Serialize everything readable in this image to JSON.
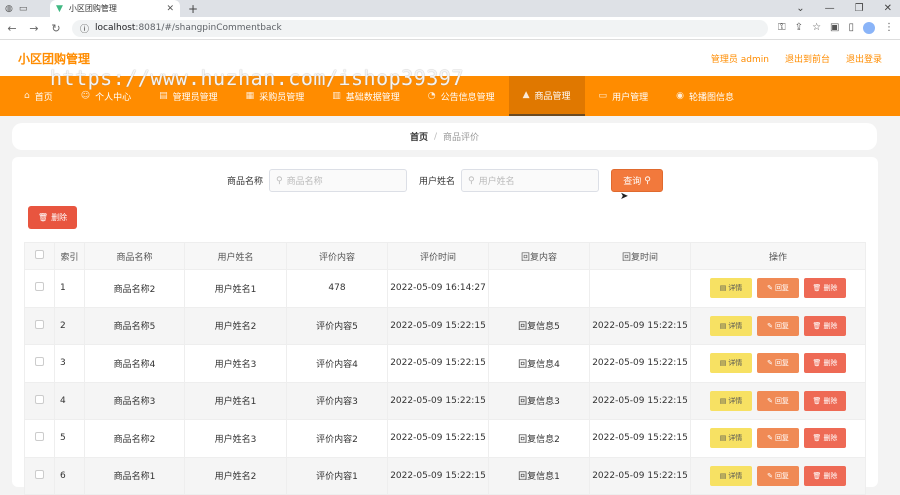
{
  "browser": {
    "tab_title": "小区团购管理",
    "url_host": "localhost",
    "url_path": ":8081/#/shangpinCommentback"
  },
  "app": {
    "title": "小区团购管理",
    "admin_label": "管理员 admin",
    "back_label": "退出到前台",
    "logout_label": "退出登录",
    "watermark": "https://www.huzhan.com/ishop39397"
  },
  "nav": [
    {
      "label": "首页",
      "icon": "home-icon"
    },
    {
      "label": "个人中心",
      "icon": "user-icon"
    },
    {
      "label": "管理员管理",
      "icon": "admin-icon"
    },
    {
      "label": "采购员管理",
      "icon": "buyer-icon"
    },
    {
      "label": "基础数据管理",
      "icon": "data-icon"
    },
    {
      "label": "公告信息管理",
      "icon": "notice-icon"
    },
    {
      "label": "商品管理",
      "icon": "goods-icon"
    },
    {
      "label": "用户管理",
      "icon": "users-icon"
    },
    {
      "label": "轮播图信息",
      "icon": "carousel-icon"
    }
  ],
  "breadcrumb": {
    "home": "首页",
    "current": "商品评价"
  },
  "search": {
    "goods_label": "商品名称",
    "goods_placeholder": "商品名称",
    "user_label": "用户姓名",
    "user_placeholder": "用户姓名",
    "button": "查询"
  },
  "delete_button": "删除",
  "table": {
    "headers": [
      "索引",
      "商品名称",
      "用户姓名",
      "评价内容",
      "评价时间",
      "回复内容",
      "回复时间",
      "操作"
    ],
    "actions": {
      "detail": "详情",
      "reply": "回复",
      "delete": "删除"
    },
    "rows": [
      {
        "idx": "1",
        "goods": "商品名称2",
        "user": "用户姓名1",
        "content": "478",
        "time": "2022-05-09 16:14:27",
        "reply": "",
        "reply_time": ""
      },
      {
        "idx": "2",
        "goods": "商品名称5",
        "user": "用户姓名2",
        "content": "评价内容5",
        "time": "2022-05-09 15:22:15",
        "reply": "回复信息5",
        "reply_time": "2022-05-09 15:22:15"
      },
      {
        "idx": "3",
        "goods": "商品名称4",
        "user": "用户姓名3",
        "content": "评价内容4",
        "time": "2022-05-09 15:22:15",
        "reply": "回复信息4",
        "reply_time": "2022-05-09 15:22:15"
      },
      {
        "idx": "4",
        "goods": "商品名称3",
        "user": "用户姓名1",
        "content": "评价内容3",
        "time": "2022-05-09 15:22:15",
        "reply": "回复信息3",
        "reply_time": "2022-05-09 15:22:15"
      },
      {
        "idx": "5",
        "goods": "商品名称2",
        "user": "用户姓名3",
        "content": "评价内容2",
        "time": "2022-05-09 15:22:15",
        "reply": "回复信息2",
        "reply_time": "2022-05-09 15:22:15"
      },
      {
        "idx": "6",
        "goods": "商品名称1",
        "user": "用户姓名2",
        "content": "评价内容1",
        "time": "2022-05-09 15:22:15",
        "reply": "回复信息1",
        "reply_time": "2022-05-09 15:22:15"
      }
    ]
  },
  "colors": {
    "accent": "#ff8c00",
    "search_btn": "#f2793c",
    "danger": "#e8553f"
  }
}
